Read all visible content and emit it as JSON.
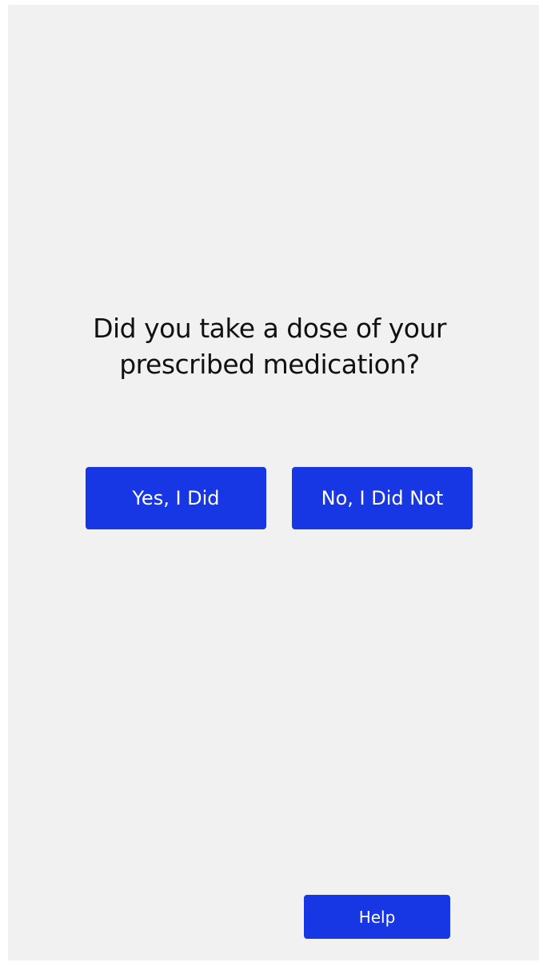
{
  "prompt": {
    "line1": "Did you take a dose of your",
    "line2": "prescribed medication?"
  },
  "actions": {
    "yes_label": "Yes, I Did",
    "no_label": "No, I Did Not",
    "help_label": "Help"
  },
  "colors": {
    "accent": "#1637e3",
    "background": "#f2f1f1",
    "text": "#111111"
  }
}
